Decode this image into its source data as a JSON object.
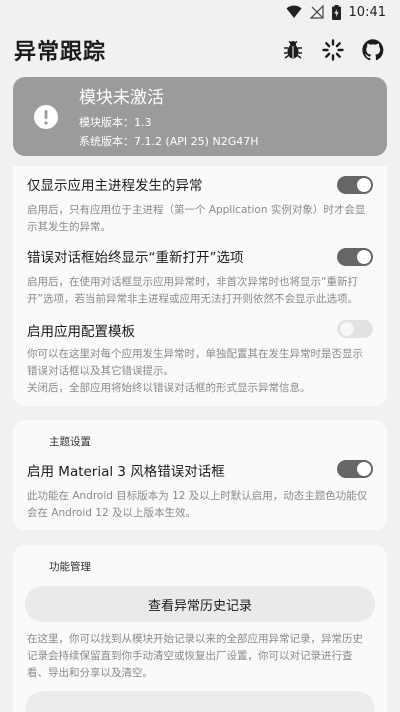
{
  "status_bar": {
    "time": "10:41"
  },
  "app_bar": {
    "title": "异常跟踪"
  },
  "module_status": {
    "title": "模块未激活",
    "module_version_line": "模块版本：1.3",
    "system_version_line": "系统版本：7.1.2 (API 25) N2G47H"
  },
  "settings": {
    "main_process": {
      "title": "仅显示应用主进程发生的异常",
      "desc": "启用后，只有应用位于主进程（第一个 Application 实例对象）时才会显示其发生的异常。",
      "enabled": true
    },
    "always_show_reopen": {
      "title": "错误对话框始终显示“重新打开”选项",
      "desc": "启用后，在使用对话框显示应用异常时，非首次异常时也将显示“重新打开”选项，若当前异常非主进程或应用无法打开则依然不会显示此选项。",
      "enabled": true
    },
    "app_config_template": {
      "title": "启用应用配置模板",
      "desc": "你可以在这里对每个应用发生异常时，单独配置其在发生异常时是否显示错误对话框以及其它错误提示。",
      "desc2": "关闭后，全部应用将始终以错误对话框的形式显示异常信息。",
      "enabled": false
    }
  },
  "theme_section": {
    "header": "主题设置",
    "material3": {
      "title": "启用 Material 3 风格错误对话框",
      "desc": "此功能在 Android 目标版本为 12 及以上时默认启用，动态主题色功能仅会在 Android 12 及以上版本生效。",
      "enabled": true
    }
  },
  "function_section": {
    "header": "功能管理",
    "history_button": "查看异常历史记录",
    "history_desc": "在这里，你可以找到从模块开始记录以来的全部应用异常记录，异常历史记录会持续保留直到你手动清空或恢复出厂设置，你可以对记录进行查看、导出和分享以及清空。"
  }
}
